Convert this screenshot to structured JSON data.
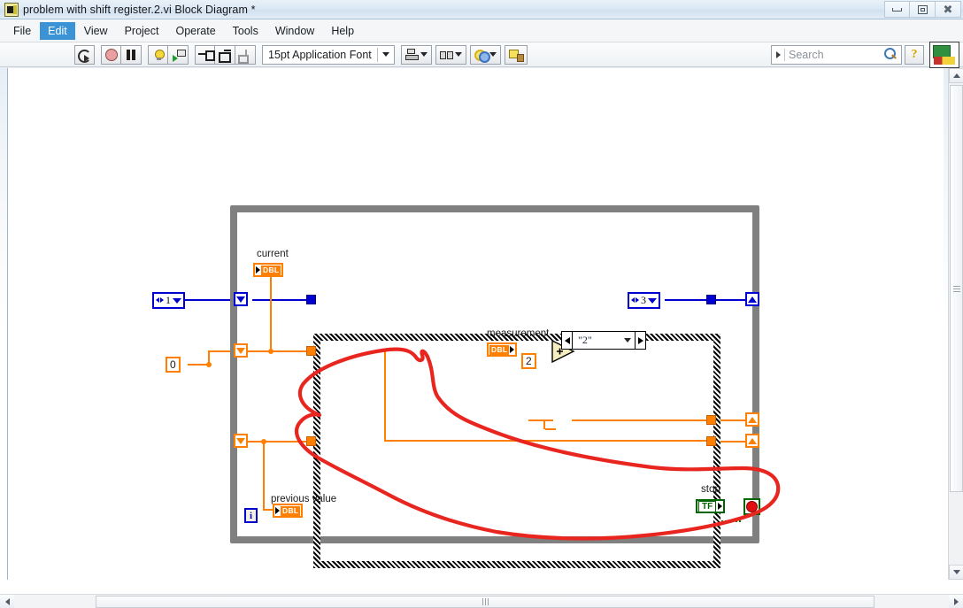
{
  "window": {
    "title": "problem with shift register.2.vi Block Diagram *",
    "icon": "labview-vi-icon",
    "controls": [
      {
        "name": "minimize",
        "glyph": "minimize-icon"
      },
      {
        "name": "restore",
        "glyph": "restore-icon"
      },
      {
        "name": "close",
        "glyph": "close-icon"
      }
    ]
  },
  "menu": {
    "items": [
      {
        "label": "File",
        "active": false
      },
      {
        "label": "Edit",
        "active": true
      },
      {
        "label": "View",
        "active": false
      },
      {
        "label": "Project",
        "active": false
      },
      {
        "label": "Operate",
        "active": false
      },
      {
        "label": "Tools",
        "active": false
      },
      {
        "label": "Window",
        "active": false
      },
      {
        "label": "Help",
        "active": false
      }
    ]
  },
  "toolbar": {
    "buttons": [
      {
        "name": "run-button",
        "icon": "run-icon"
      },
      {
        "name": "run-continuously-button",
        "icon": "run-continuously-icon"
      },
      {
        "name": "abort-execution-button",
        "icon": "abort-icon"
      },
      {
        "name": "pause-button",
        "icon": "pause-icon"
      },
      {
        "name": "highlight-execution-button",
        "icon": "light-bulb-icon"
      },
      {
        "name": "retain-wire-values-button",
        "icon": "probe-icon"
      },
      {
        "name": "step-into-button",
        "icon": "step-into-icon"
      },
      {
        "name": "step-over-button",
        "icon": "step-over-icon"
      },
      {
        "name": "step-out-button",
        "icon": "step-out-icon"
      }
    ],
    "font_selector": {
      "value": "15pt Application Font",
      "caret": "chevron-down-icon"
    },
    "dropdowns": [
      {
        "name": "align-objects",
        "icon": "align-objects-icon"
      },
      {
        "name": "distribute-objects",
        "icon": "distribute-objects-icon"
      },
      {
        "name": "reorder",
        "icon": "reorder-icon"
      }
    ],
    "clean_up": {
      "name": "clean-up-diagram",
      "icon": "clean-up-diagram-icon"
    },
    "search": {
      "placeholder": "Search",
      "value": "",
      "icon": "magnifier-icon"
    },
    "help": {
      "label": "?",
      "name": "context-help-button"
    },
    "vi_icon": "vi-icon"
  },
  "diagram": {
    "while_loop": {
      "name": "while-loop",
      "iteration_terminal": "i",
      "stop_label": "stop",
      "stop_terminal_value": "TF",
      "stop_condition": "stop-if-true-icon"
    },
    "case_structure": {
      "name": "case-structure",
      "selector_value": "\"2\"",
      "left_arrow": "prev-case-icon",
      "right_arrow": "next-case-icon",
      "caret": "chevron-down-icon"
    },
    "terminals": [
      {
        "name": "current-indicator",
        "label": "current",
        "datatype": "DBL"
      },
      {
        "name": "measurement-indicator",
        "label": "measurement",
        "datatype": "DBL"
      },
      {
        "name": "previous-value-indicator",
        "label": "previous value",
        "datatype": "DBL"
      }
    ],
    "constants": [
      {
        "name": "zero-constant",
        "value": "0"
      },
      {
        "name": "two-constant",
        "value": "2"
      }
    ],
    "numeric_controls": [
      {
        "name": "numeric-control-1",
        "value": "1"
      },
      {
        "name": "numeric-control-3",
        "value": "3"
      }
    ],
    "primitives": [
      {
        "name": "add-node",
        "symbol": "+"
      }
    ],
    "annotation": {
      "name": "red-ink-annotation",
      "color": "#e8251f",
      "description": "hand-drawn red loop around the lower shift register wiring"
    },
    "colors": {
      "double_wire": "#ff7f00",
      "integer_wire": "#0000d0",
      "boolean_wire": "#008000",
      "loop_border": "#808080",
      "annotation": "#e8251f"
    }
  }
}
